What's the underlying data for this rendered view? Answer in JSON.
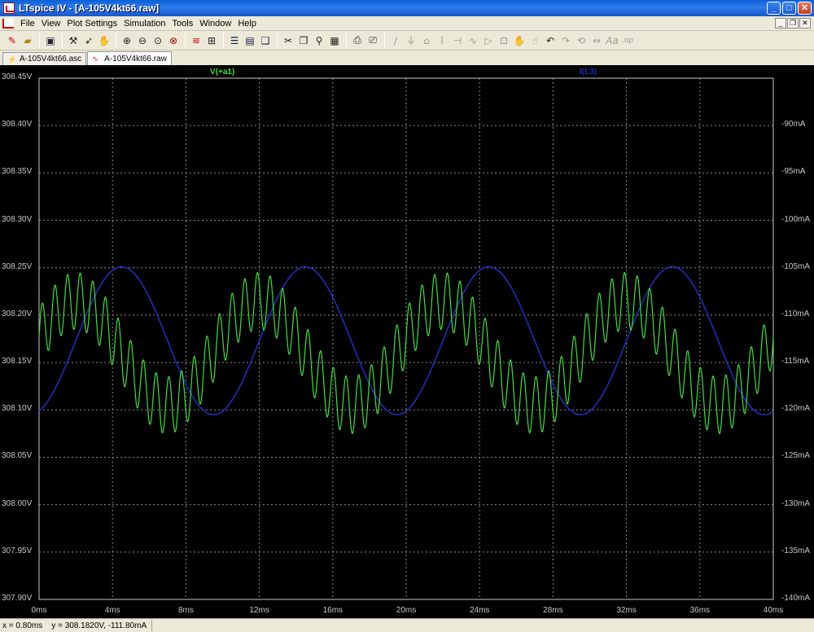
{
  "window": {
    "title": "LTspice IV - [A-105V4kt66.raw]",
    "min": "_",
    "max": "□",
    "close": "✕"
  },
  "menu": [
    "File",
    "View",
    "Plot Settings",
    "Simulation",
    "Tools",
    "Window",
    "Help"
  ],
  "mdi": {
    "min": "_",
    "restore": "❐",
    "close": "✕"
  },
  "toolbar": {
    "icons": [
      "run-icon",
      "open-icon",
      "save-icon",
      "control-panel-icon",
      "run-sim-icon",
      "halt-icon",
      "zoom-in-icon",
      "zoom-out-icon",
      "zoom-full-icon",
      "zoom-cancel-icon",
      "autorange-icon",
      "tile-horizontal-icon",
      "tile-vertical-icon",
      "cascade-icon",
      "cut-icon",
      "copy-icon",
      "find-icon",
      "paste-icon",
      "print-preview-icon",
      "print-icon",
      "wire-icon",
      "ground-icon",
      "label-icon",
      "resistor-icon",
      "capacitor-icon",
      "inductor-icon",
      "diode-icon",
      "component-icon",
      "move-icon",
      "drag-icon",
      "undo-icon",
      "redo-icon",
      "rotate-icon",
      "mirror-icon",
      "text-icon",
      "spice-directive-icon"
    ]
  },
  "tabs": [
    {
      "label": "A-105V4kt66.asc",
      "icon": "schematic-icon",
      "active": false
    },
    {
      "label": "A-105V4kt66.raw",
      "icon": "waveform-icon",
      "active": true
    }
  ],
  "colors": {
    "v_trace": "#3ee03a",
    "i_trace": "#1c2fb8",
    "grid": "#8a8a8a",
    "axis": "#c8c8c8"
  },
  "chart_data": {
    "type": "line",
    "x_unit": "ms",
    "xlim": [
      0,
      40
    ],
    "x_ticks": [
      "0ms",
      "4ms",
      "8ms",
      "12ms",
      "16ms",
      "20ms",
      "24ms",
      "28ms",
      "32ms",
      "36ms",
      "40ms"
    ],
    "y_left": {
      "lim": [
        307.9,
        308.45
      ],
      "ticks": [
        "308.45V",
        "308.40V",
        "308.35V",
        "308.30V",
        "308.25V",
        "308.20V",
        "308.15V",
        "308.10V",
        "308.05V",
        "308.00V",
        "307.95V",
        "307.90V"
      ]
    },
    "y_right": {
      "lim": [
        -140,
        -85
      ],
      "ticks": [
        "-90mA",
        "-95mA",
        "-100mA",
        "-105mA",
        "-110mA",
        "-115mA",
        "-120mA",
        "-125mA",
        "-130mA",
        "-135mA",
        "-140mA"
      ]
    },
    "grid": true,
    "series": [
      {
        "name": "V(+a1)",
        "axis": "left",
        "model": "offset + fundamental + ripple",
        "offset_V": 308.16,
        "period_ms": 10,
        "fundamental_amp_V": 0.055,
        "fundamental_peak_ms": 2,
        "ripple_amp_V": 0.03,
        "ripple_freq_kHz": 1.45
      },
      {
        "name": "I(L3)",
        "axis": "right",
        "model": "sinusoid",
        "center_mA": -112.7,
        "amp_mA": 7.8,
        "period_ms": 10,
        "peak_ms": 4.5,
        "color": "#1c2fb8"
      }
    ]
  },
  "status": "x = 0.80ms    y = 308.1820V, -111.80mA"
}
